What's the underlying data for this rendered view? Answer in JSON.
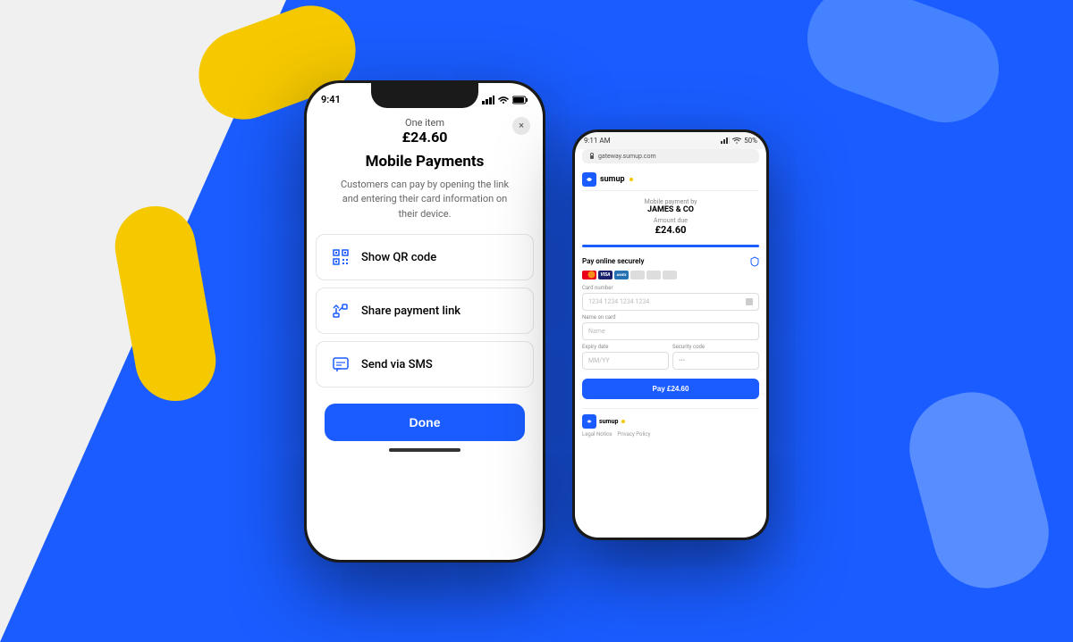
{
  "background": {
    "white_section": "light gray background left",
    "blue_section": "blue background right",
    "blue_color": "#1a5cff",
    "yellow_color": "#f5c800"
  },
  "iphone": {
    "status_bar": {
      "time": "9:41",
      "signal": "●●●",
      "wifi": "wifi",
      "battery": "battery"
    },
    "modal": {
      "subtitle_amount": "One item",
      "price": "£24.60",
      "title": "Mobile Payments",
      "description": "Customers can pay by opening the link and entering their card information on their device.",
      "close_label": "×"
    },
    "menu_items": [
      {
        "icon": "qr-icon",
        "label": "Show QR code"
      },
      {
        "icon": "share-icon",
        "label": "Share payment link"
      },
      {
        "icon": "sms-icon",
        "label": "Send via SMS"
      }
    ],
    "done_button": "Done"
  },
  "android": {
    "status_bar": {
      "time": "9:11 AM",
      "battery": "50%"
    },
    "url_bar": "gateway.sumup.com",
    "sumup_logo_text": "sumup",
    "payment_by_label": "Mobile payment by",
    "merchant_name": "JAMES & CO",
    "amount_label": "Amount due",
    "amount": "£24.60",
    "pay_online_label": "Pay online securely",
    "card_number_label": "Card number",
    "card_number_placeholder": "1234 1234 1234 1234",
    "name_label": "Name on card",
    "name_placeholder": "Name",
    "expiry_label": "Expiry date",
    "expiry_placeholder": "MM/YY",
    "security_label": "Security code",
    "security_placeholder": "•••",
    "pay_button": "Pay £24.60",
    "footer_logo": "sumup",
    "legal_notice_label": "Legal Notice",
    "privacy_policy_label": "Privacy Policy"
  }
}
